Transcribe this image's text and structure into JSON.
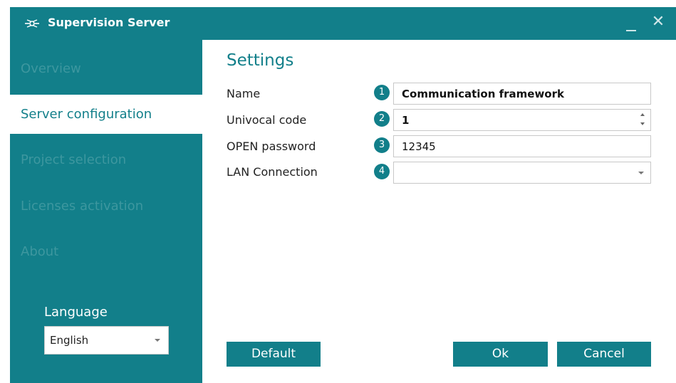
{
  "window": {
    "title": "Supervision Server",
    "app_icon": "app-logo-icon",
    "minimize_icon": "minimize-icon",
    "close_icon": "close-icon",
    "close_glyph": "✕"
  },
  "sidebar": {
    "items": [
      {
        "label": "Overview",
        "active": false
      },
      {
        "label": "Server configuration",
        "active": true
      },
      {
        "label": "Project selection",
        "active": false
      },
      {
        "label": "Licenses activation",
        "active": false
      },
      {
        "label": "About",
        "active": false
      }
    ],
    "language_label": "Language",
    "language_value": "English"
  },
  "settings": {
    "heading": "Settings",
    "fields": [
      {
        "badge": "1",
        "label": "Name",
        "value": "Communication framework"
      },
      {
        "badge": "2",
        "label": "Univocal code",
        "value": "1"
      },
      {
        "badge": "3",
        "label": "OPEN password",
        "value": "12345"
      },
      {
        "badge": "4",
        "label": "LAN Connection",
        "value": ""
      }
    ]
  },
  "buttons": {
    "default": "Default",
    "ok": "Ok",
    "cancel": "Cancel"
  },
  "colors": {
    "accent": "#127f8a",
    "sidebar_text_inactive": "#3d979f",
    "content_bg": "#ffffff"
  }
}
